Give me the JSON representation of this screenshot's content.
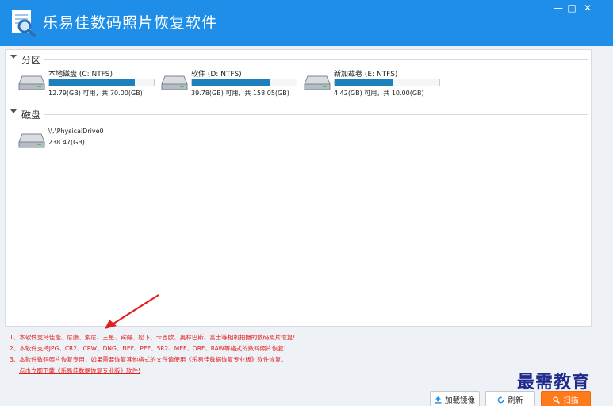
{
  "app": {
    "title": "乐易佳数码照片恢复软件"
  },
  "window_controls": {
    "minimize": "—",
    "maximize": "□",
    "close": "✕"
  },
  "partitions": {
    "title": "分区",
    "items": [
      {
        "name": "本地磁盘 (C: NTFS)",
        "capacity": "12.79(GB) 可用，共 70.00(GB)",
        "fill_percent": 82
      },
      {
        "name": "软件 (D: NTFS)",
        "capacity": "39.78(GB) 可用，共 158.05(GB)",
        "fill_percent": 75
      },
      {
        "name": "新加载卷 (E: NTFS)",
        "capacity": "4.42(GB) 可用，共 10.00(GB)",
        "fill_percent": 56
      }
    ]
  },
  "disks": {
    "title": "磁盘",
    "items": [
      {
        "name": "\\\\.\\PhysicalDrive0",
        "size": "238.47(GB)"
      }
    ]
  },
  "notices": [
    "1、本软件支持佳能、尼康、索尼、三星、宾得、松下、卡西欧、奥林巴斯、富士等相机拍摄的数码照片恢复!",
    "2、本软件支持JPG、CR2、CRW、DNG、NEF、PEF、SR2、MEF、ORF、RAW等格式的数码照片恢复!",
    "3、本软件数码照片恢复专用，如果需要恢复其他格式的文件请使用《乐易佳数据恢复专业版》软件恢复。"
  ],
  "notice_link": "点击立即下载《乐易佳数据恢复专业版》软件!",
  "buttons": {
    "load_image": "加载镜像",
    "refresh": "刷新",
    "scan": "扫描"
  },
  "watermark": "最需教育",
  "colors": {
    "titlebar": "#1e8ee8",
    "accent_orange": "#ff7a1a",
    "notice_red": "#e02020",
    "bar_fill": "#1b80bc"
  }
}
